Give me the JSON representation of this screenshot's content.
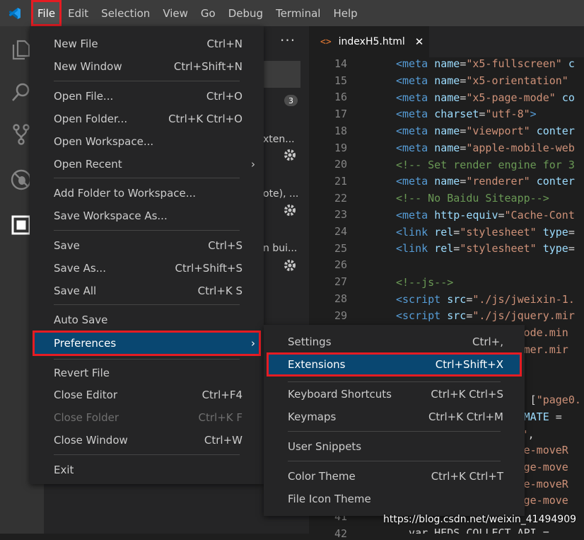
{
  "menubar": {
    "items": [
      {
        "label": "File"
      },
      {
        "label": "Edit"
      },
      {
        "label": "Selection"
      },
      {
        "label": "View"
      },
      {
        "label": "Go"
      },
      {
        "label": "Debug"
      },
      {
        "label": "Terminal"
      },
      {
        "label": "Help"
      }
    ]
  },
  "sidebar": {
    "dots": "···",
    "badge_count": "3",
    "ext_snippets": [
      "xten...",
      "ote), ...",
      "n bui..."
    ]
  },
  "editor": {
    "tab": {
      "icon": "<>",
      "label": "indexH5.html",
      "close": "✕"
    },
    "line_numbers": [
      "14",
      "15",
      "16",
      "17",
      "18",
      "19",
      "20",
      "21",
      "22",
      "23",
      "24",
      "25",
      "26",
      "27",
      "28",
      "29",
      "",
      "",
      "",
      "",
      "",
      "",
      "",
      "",
      "",
      "",
      "",
      "41",
      "42"
    ]
  },
  "file_menu": {
    "items": {
      "new_file": {
        "label": "New File",
        "shortcut": "Ctrl+N"
      },
      "new_window": {
        "label": "New Window",
        "shortcut": "Ctrl+Shift+N"
      },
      "open_file": {
        "label": "Open File...",
        "shortcut": "Ctrl+O"
      },
      "open_folder": {
        "label": "Open Folder...",
        "shortcut": "Ctrl+K Ctrl+O"
      },
      "open_workspace": {
        "label": "Open Workspace..."
      },
      "open_recent": {
        "label": "Open Recent"
      },
      "add_folder": {
        "label": "Add Folder to Workspace..."
      },
      "save_workspace_as": {
        "label": "Save Workspace As..."
      },
      "save": {
        "label": "Save",
        "shortcut": "Ctrl+S"
      },
      "save_as": {
        "label": "Save As...",
        "shortcut": "Ctrl+Shift+S"
      },
      "save_all": {
        "label": "Save All",
        "shortcut": "Ctrl+K S"
      },
      "auto_save": {
        "label": "Auto Save"
      },
      "preferences": {
        "label": "Preferences"
      },
      "revert_file": {
        "label": "Revert File"
      },
      "close_editor": {
        "label": "Close Editor",
        "shortcut": "Ctrl+F4"
      },
      "close_folder": {
        "label": "Close Folder",
        "shortcut": "Ctrl+K F"
      },
      "close_window": {
        "label": "Close Window",
        "shortcut": "Ctrl+W"
      },
      "exit": {
        "label": "Exit"
      }
    }
  },
  "prefs_menu": {
    "items": {
      "settings": {
        "label": "Settings",
        "shortcut": "Ctrl+,"
      },
      "extensions": {
        "label": "Extensions",
        "shortcut": "Ctrl+Shift+X"
      },
      "keyboard_shortcuts": {
        "label": "Keyboard Shortcuts",
        "shortcut": "Ctrl+K Ctrl+S"
      },
      "keymaps": {
        "label": "Keymaps",
        "shortcut": "Ctrl+K Ctrl+M"
      },
      "user_snippets": {
        "label": "User Snippets"
      },
      "color_theme": {
        "label": "Color Theme",
        "shortcut": "Ctrl+K Ctrl+T"
      },
      "file_icon_theme": {
        "label": "File Icon Theme"
      }
    }
  },
  "watermark": "https://blog.csdn.net/weixin_41494909",
  "colors": {
    "highlight": "#e51c23",
    "selection": "#094771",
    "menu_bg": "#252526"
  }
}
